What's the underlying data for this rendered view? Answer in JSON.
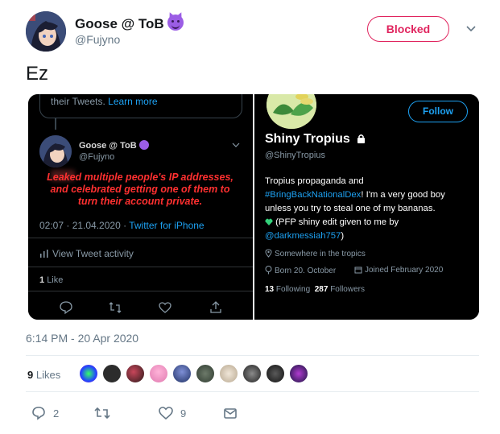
{
  "user": {
    "display_name": "Goose @ ToB",
    "handle": "@Fujyno",
    "blocked_label": "Blocked",
    "emoji": "smiling-devil-emoji"
  },
  "tweet": {
    "text": "Ez",
    "timestamp": "6:14 PM - 20 Apr 2020",
    "likes_count": "9",
    "likes_label": "Likes",
    "actions": {
      "reply_count": "2",
      "retweet_count": "",
      "like_count": "9"
    }
  },
  "screenshot": {
    "left": {
      "quote_text": "their Tweets.",
      "quote_link": "Learn more",
      "name": "Goose @ ToB",
      "handle": "@Fujyno",
      "leak_text": "Leaked multiple people's IP addresses, and celebrated getting one of them to turn their account private.",
      "time": "02:07 · 21.04.2020 ·",
      "client": "Twitter for iPhone",
      "activity": "View Tweet activity",
      "likes_number": "1",
      "likes_word": "Like"
    },
    "right": {
      "follow_label": "Follow",
      "name": "Shiny Tropius",
      "handle": "@ShinyTropius",
      "bio_1": "Tropius propaganda and",
      "bio_link": "#BringBackNationalDex",
      "bio_2": "! I'm a very good boy unless you try to steal one of my bananas.",
      "bio_3": "(PFP shiny edit given to me by",
      "bio_mention": "@darkmessiah757",
      "bio_end": ")",
      "location": "Somewhere in the tropics",
      "born": "Born 20. October",
      "joined": "Joined February 2020",
      "following_count": "13",
      "following_label": "Following",
      "followers_count": "287",
      "followers_label": "Followers"
    }
  },
  "colors": {
    "blocked": "#e0245e",
    "link": "#1da1f2",
    "leak_text": "#ff3030",
    "muted": "#657786"
  }
}
